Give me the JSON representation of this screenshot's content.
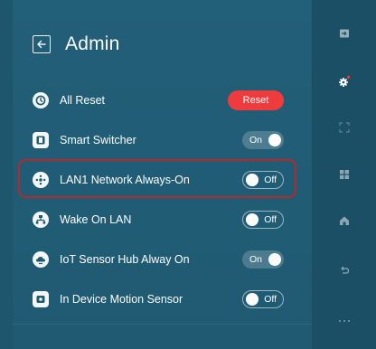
{
  "header": {
    "title": "Admin"
  },
  "colors": {
    "panel": "#1f5a72",
    "rail": "#1a4f65",
    "reset": "#ee3b3e",
    "highlight": "#b5282b"
  },
  "settings": [
    {
      "label": "All Reset",
      "icon": "reset-icon",
      "control": "button",
      "value": "Reset"
    },
    {
      "label": "Smart Switcher",
      "icon": "switcher-icon",
      "control": "toggle",
      "state": "on",
      "value": "On"
    },
    {
      "label": "LAN1 Network Always-On",
      "icon": "network-icon",
      "control": "toggle",
      "state": "off",
      "value": "Off",
      "highlighted": true
    },
    {
      "label": "Wake On LAN",
      "icon": "wake-on-lan-icon",
      "control": "toggle",
      "state": "off",
      "value": "Off"
    },
    {
      "label": "IoT Sensor Hub Alway On",
      "icon": "iot-sensor-icon",
      "control": "toggle",
      "state": "on",
      "value": "On"
    },
    {
      "label": "In Device Motion Sensor",
      "icon": "motion-sensor-icon",
      "control": "toggle",
      "state": "off",
      "value": "Off"
    }
  ],
  "rail": [
    {
      "icon": "input-icon"
    },
    {
      "icon": "settings-gear-icon",
      "active": true
    },
    {
      "icon": "screen-capture-icon"
    },
    {
      "icon": "apps-grid-icon"
    },
    {
      "icon": "home-icon"
    },
    {
      "icon": "back-arrow-icon"
    },
    {
      "icon": "more-icon"
    }
  ]
}
